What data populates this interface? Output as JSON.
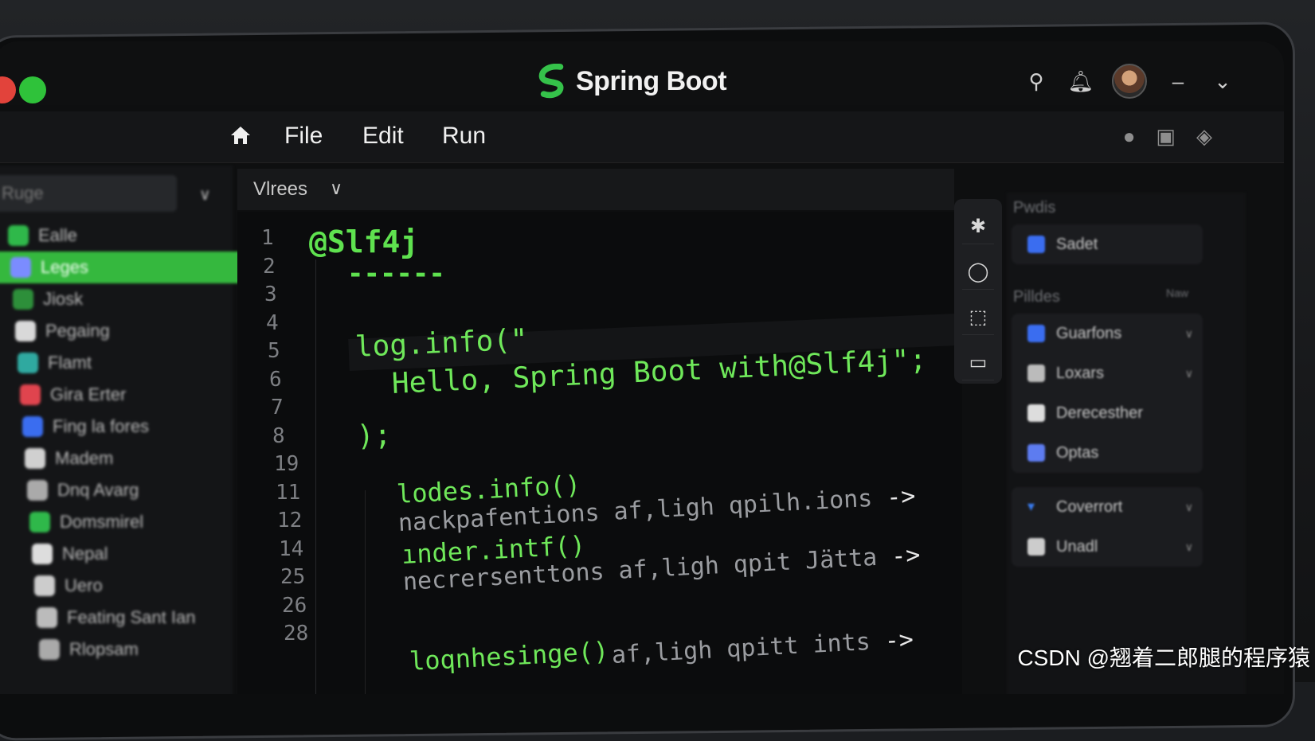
{
  "window": {
    "brand_name": "Spring Boot",
    "traffic_lights": [
      "close",
      "zoom"
    ]
  },
  "menu": {
    "items": [
      "File",
      "Edit",
      "Run"
    ]
  },
  "sidebar": {
    "search_placeholder": "Ruge",
    "items": [
      {
        "label": "Ealle",
        "icon": "circle-icon",
        "color": "#2fb84a",
        "active": false
      },
      {
        "label": "Leges",
        "icon": "person-icon",
        "color": "#7b8cff",
        "active": true
      },
      {
        "label": "Jiosk",
        "icon": "folder-icon",
        "color": "#2d8f3a",
        "active": false
      },
      {
        "label": "Pegaing",
        "icon": "file-icon",
        "color": "#d9d9d9",
        "active": false
      },
      {
        "label": "Flamt",
        "icon": "box-icon",
        "color": "#2fa9a0",
        "active": false
      },
      {
        "label": "Gira Erter",
        "icon": "grid-icon",
        "color": "#e0444e",
        "active": false
      },
      {
        "label": "Fing la fores",
        "icon": "diamond-icon",
        "color": "#3a6df0",
        "active": false
      },
      {
        "label": "Madem",
        "icon": "mail-icon",
        "color": "#d0d0d0",
        "active": false
      },
      {
        "label": "Dnq Avarg",
        "icon": "gear-icon",
        "color": "#aaaaaa",
        "active": false
      },
      {
        "label": "Domsmirel",
        "icon": "leaf-icon",
        "color": "#2fb84a",
        "active": false
      },
      {
        "label": "Nepal",
        "icon": "doc-icon",
        "color": "#dddddd",
        "active": false
      },
      {
        "label": "Uero",
        "icon": "circle-icon",
        "color": "#cccccc",
        "active": false
      },
      {
        "label": "Feating Sant Ian",
        "icon": "user-icon",
        "color": "#bbbbbb",
        "active": false
      },
      {
        "label": "Rlopsam",
        "icon": "doc-icon",
        "color": "#aaaaaa",
        "active": false
      }
    ]
  },
  "view": {
    "label": "Vlrees"
  },
  "editor": {
    "line_numbers": [
      "1",
      "2",
      "3",
      "4",
      "5",
      "6",
      "7",
      "8",
      "19",
      "11",
      "12",
      "14",
      "25",
      "26",
      "28"
    ],
    "annotation": "@Slf4j",
    "dashes": "------",
    "log_line_1": "log.info(\"",
    "log_line_2": "Hello, Spring Boot with@Slf4j\";",
    "log_line_3": ");",
    "block_1_code": "lodes.info()",
    "block_1_desc": "nackpafentions af,ligh qpilh.ions",
    "block_2_code": "ınder.intf()",
    "block_2_desc": "necrersenttons af,ligh qpit Jätta",
    "block_3_code": "loqnhesinge()",
    "block_3_desc": "af,ligh qpitt ints",
    "arrow": "->"
  },
  "floating_toolbar": {
    "buttons": [
      "asterisk-icon",
      "circle-icon",
      "crop-icon",
      "comment-icon"
    ]
  },
  "right_panel": {
    "header": "Pwdis",
    "top_item": "Sadet",
    "section_label": "Pilldes",
    "section_hint": "Naw",
    "group_1": [
      "Guarfons",
      "Loxars",
      "Derecesther",
      "Optas"
    ],
    "group_2": [
      "Coverrort",
      "Unadl"
    ]
  },
  "watermark": "CSDN @翘着二郎腿的程序猿",
  "colors": {
    "accent_green": "#35b83e",
    "code_green": "#6fe85a",
    "background": "#0e0f10"
  }
}
